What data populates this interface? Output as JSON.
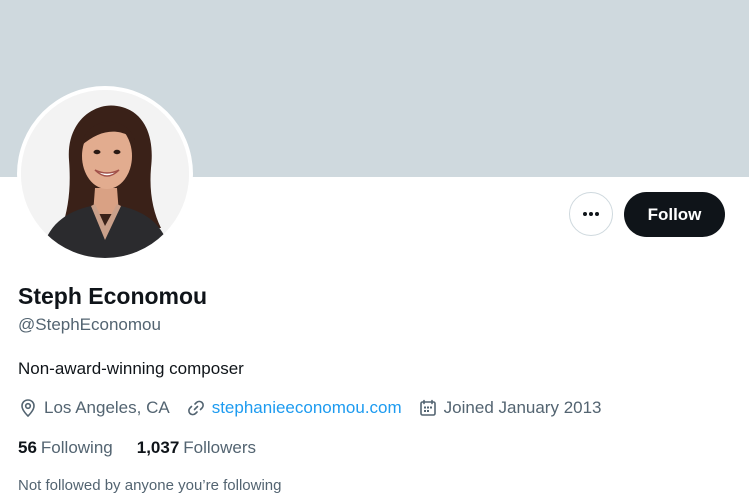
{
  "profile": {
    "name": "Steph Economou",
    "handle": "@StephEconomou",
    "bio": "Non-award-winning composer",
    "location": "Los Angeles, CA",
    "website": "stephanieeconomou.com",
    "joined": "Joined January 2013"
  },
  "actions": {
    "more_icon": "ellipsis-icon",
    "follow_label": "Follow"
  },
  "stats": {
    "following_count": "56",
    "following_label": "Following",
    "followers_count": "1,037",
    "followers_label": "Followers"
  },
  "mutuals_note": "Not followed by anyone you’re following",
  "colors": {
    "banner": "#cfd9de",
    "link": "#1d9bf0",
    "follow_button": "#0f1419",
    "secondary_text": "#536471"
  }
}
